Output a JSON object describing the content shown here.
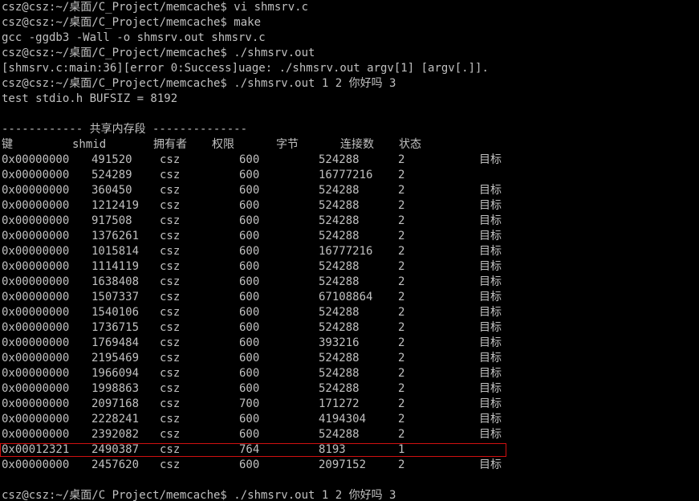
{
  "terminal": {
    "lines": [
      "csz@csz:~/桌面/C_Project/memcache$ vi shmsrv.c",
      "csz@csz:~/桌面/C_Project/memcache$ make",
      "gcc -ggdb3 -Wall -o shmsrv.out shmsrv.c",
      "csz@csz:~/桌面/C_Project/memcache$ ./shmsrv.out",
      "[shmsrv.c:main:36][error 0:Success]uage: ./shmsrv.out argv[1] [argv[.]].",
      "csz@csz:~/桌面/C_Project/memcache$ ./shmsrv.out 1 2 你好吗 3",
      "test stdio.h BUFSIZ = 8192",
      "",
      "------------ 共享内存段 --------------"
    ],
    "final_prompt": "csz@csz:~/桌面/C Project/memcache$ ./shmsrv.out 1 2 你好吗 3"
  },
  "table": {
    "headers": {
      "key": "键",
      "shmid": "shmid",
      "owner": "拥有者",
      "perms": "权限",
      "bytes": "字节",
      "nattch": "连接数",
      "status": "状态"
    },
    "rows": [
      {
        "key": "0x00000000",
        "shmid": "491520",
        "owner": "csz",
        "perms": "600",
        "bytes": "524288",
        "nattch": "2",
        "status": "目标"
      },
      {
        "key": "0x00000000",
        "shmid": "524289",
        "owner": "csz",
        "perms": "600",
        "bytes": "16777216",
        "nattch": "2",
        "status": ""
      },
      {
        "key": "0x00000000",
        "shmid": "360450",
        "owner": "csz",
        "perms": "600",
        "bytes": "524288",
        "nattch": "2",
        "status": "目标"
      },
      {
        "key": "0x00000000",
        "shmid": "1212419",
        "owner": "csz",
        "perms": "600",
        "bytes": "524288",
        "nattch": "2",
        "status": "目标"
      },
      {
        "key": "0x00000000",
        "shmid": "917508",
        "owner": "csz",
        "perms": "600",
        "bytes": "524288",
        "nattch": "2",
        "status": "目标"
      },
      {
        "key": "0x00000000",
        "shmid": "1376261",
        "owner": "csz",
        "perms": "600",
        "bytes": "524288",
        "nattch": "2",
        "status": "目标"
      },
      {
        "key": "0x00000000",
        "shmid": "1015814",
        "owner": "csz",
        "perms": "600",
        "bytes": "16777216",
        "nattch": "2",
        "status": "目标"
      },
      {
        "key": "0x00000000",
        "shmid": "1114119",
        "owner": "csz",
        "perms": "600",
        "bytes": "524288",
        "nattch": "2",
        "status": "目标"
      },
      {
        "key": "0x00000000",
        "shmid": "1638408",
        "owner": "csz",
        "perms": "600",
        "bytes": "524288",
        "nattch": "2",
        "status": "目标"
      },
      {
        "key": "0x00000000",
        "shmid": "1507337",
        "owner": "csz",
        "perms": "600",
        "bytes": "67108864",
        "nattch": "2",
        "status": "目标"
      },
      {
        "key": "0x00000000",
        "shmid": "1540106",
        "owner": "csz",
        "perms": "600",
        "bytes": "524288",
        "nattch": "2",
        "status": "目标"
      },
      {
        "key": "0x00000000",
        "shmid": "1736715",
        "owner": "csz",
        "perms": "600",
        "bytes": "524288",
        "nattch": "2",
        "status": "目标"
      },
      {
        "key": "0x00000000",
        "shmid": "1769484",
        "owner": "csz",
        "perms": "600",
        "bytes": "393216",
        "nattch": "2",
        "status": "目标"
      },
      {
        "key": "0x00000000",
        "shmid": "2195469",
        "owner": "csz",
        "perms": "600",
        "bytes": "524288",
        "nattch": "2",
        "status": "目标"
      },
      {
        "key": "0x00000000",
        "shmid": "1966094",
        "owner": "csz",
        "perms": "600",
        "bytes": "524288",
        "nattch": "2",
        "status": "目标"
      },
      {
        "key": "0x00000000",
        "shmid": "1998863",
        "owner": "csz",
        "perms": "600",
        "bytes": "524288",
        "nattch": "2",
        "status": "目标"
      },
      {
        "key": "0x00000000",
        "shmid": "2097168",
        "owner": "csz",
        "perms": "700",
        "bytes": "171272",
        "nattch": "2",
        "status": "目标"
      },
      {
        "key": "0x00000000",
        "shmid": "2228241",
        "owner": "csz",
        "perms": "600",
        "bytes": "4194304",
        "nattch": "2",
        "status": "目标"
      },
      {
        "key": "0x00000000",
        "shmid": "2392082",
        "owner": "csz",
        "perms": "600",
        "bytes": "524288",
        "nattch": "2",
        "status": "目标"
      },
      {
        "key": "0x00012321",
        "shmid": "2490387",
        "owner": "csz",
        "perms": "764",
        "bytes": "8193",
        "nattch": "1",
        "status": ""
      },
      {
        "key": "0x00000000",
        "shmid": "2457620",
        "owner": "csz",
        "perms": "600",
        "bytes": "2097152",
        "nattch": "2",
        "status": "目标"
      }
    ],
    "highlighted_row_index": 19
  },
  "colors": {
    "background": "#000000",
    "text": "#c0c0c0",
    "highlight_border": "#d01010"
  }
}
